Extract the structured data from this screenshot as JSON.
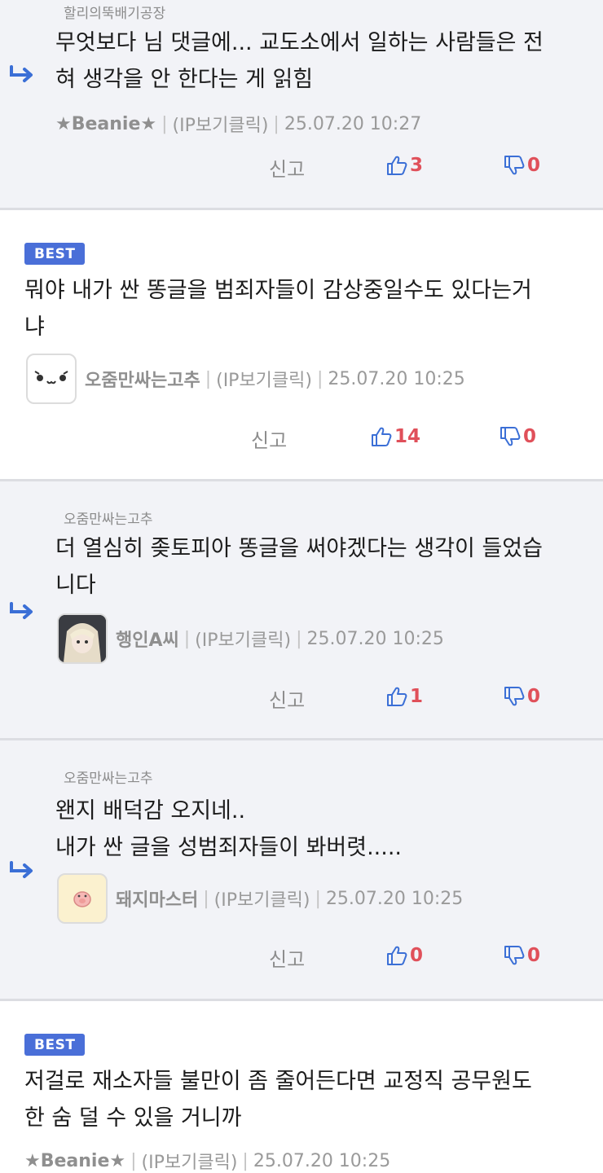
{
  "colors": {
    "accent": "#3b6fd6",
    "count": "#e0505a",
    "best": "#4a6fd8"
  },
  "comments": [
    {
      "reply_to": "할리의뚝배기공장",
      "text": "무엇보다 님 댓글에... 교도소에서 일하는 사람들은 전\n혀 생각을 안 한다는 게 읽힘",
      "author": "★Beanie★",
      "ip": "(IP보기클릭)",
      "datetime": "25.07.20 10:27",
      "report": "신고",
      "likes": "3",
      "dislikes": "0"
    },
    {
      "badge": "BEST",
      "text": "뭐야 내가 싼 똥글을 범죄자들이 감상중일수도 있다는거\n냐",
      "author": "오줌만싸는고추",
      "ip": "(IP보기클릭)",
      "datetime": "25.07.20 10:25",
      "report": "신고",
      "likes": "14",
      "dislikes": "0"
    },
    {
      "reply_to": "오줌만싸는고추",
      "text": "더 열심히 좆토피아 똥글을 써야겠다는 생각이 들었습\n니다",
      "author": "행인A씨",
      "ip": "(IP보기클릭)",
      "datetime": "25.07.20 10:25",
      "report": "신고",
      "likes": "1",
      "dislikes": "0"
    },
    {
      "reply_to": "오줌만싸는고추",
      "text": "왠지 배덕감 오지네..\n내가 싼 글을 성범죄자들이 봐버렷.....",
      "author": "돼지마스터",
      "ip": "(IP보기클릭)",
      "datetime": "25.07.20 10:25",
      "report": "신고",
      "likes": "0",
      "dislikes": "0"
    },
    {
      "badge": "BEST",
      "text": "저걸로 재소자들 불만이 좀 줄어든다면 교정직 공무원도\n한 숨 덜 수 있을 거니까",
      "author": "★Beanie★",
      "ip": "(IP보기클릭)",
      "datetime": "25.07.20 10:25"
    }
  ]
}
